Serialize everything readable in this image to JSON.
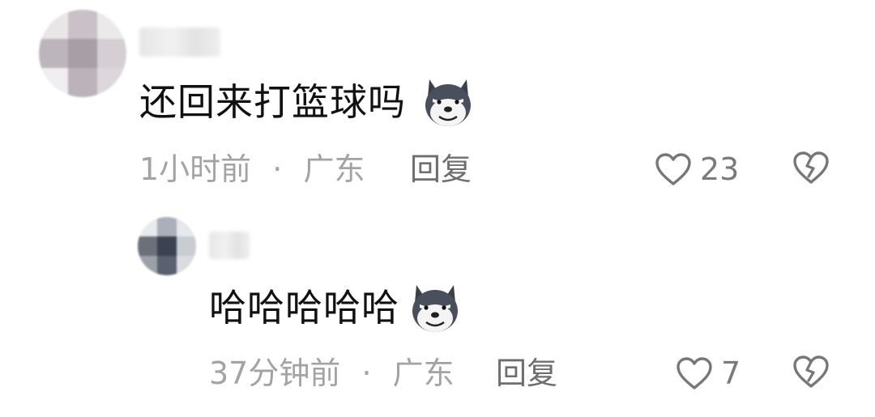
{
  "comments": [
    {
      "text": "还回来打篮球吗",
      "emoji": "husky-dog-emoji",
      "time": "1小时前",
      "separator": "·",
      "location": "广东",
      "reply_label": "回复",
      "likes": "23"
    },
    {
      "text": "哈哈哈哈哈",
      "emoji": "husky-dog-emoji",
      "time": "37分钟前",
      "separator": "·",
      "location": "广东",
      "reply_label": "回复",
      "likes": "7"
    }
  ],
  "icons": {
    "like": "heart-outline-icon",
    "dislike": "broken-heart-icon"
  },
  "colors": {
    "text": "#111111",
    "meta": "#a3a3a3",
    "reply": "#6e6e6e",
    "icon": "#777777"
  }
}
